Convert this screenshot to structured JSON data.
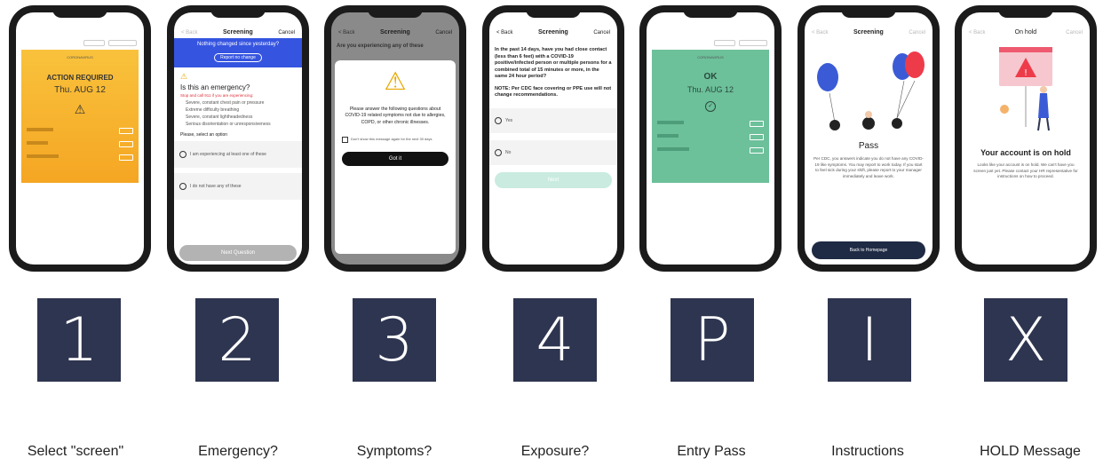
{
  "screens": [
    {
      "id": "1",
      "caption": "Select \"screen\"",
      "card": {
        "date_line": "Thu. AUG 12",
        "status": "ACTION REQUIRED",
        "header_small": "CORONAVIRUS"
      }
    },
    {
      "id": "2",
      "caption": "Emergency?",
      "nav": {
        "back": "< Back",
        "title": "Screening",
        "cancel": "Cancel"
      },
      "banner": {
        "text": "Nothing changed since yesterday?",
        "button": "Report no change"
      },
      "question": "Is this an emergency?",
      "warning": "Stop and call 911 if you are experiencing:",
      "bullets": [
        "Severe, constant chest pain or pressure",
        "Extreme difficulty breathing",
        "Severe, constant lightheadedness",
        "Serious disorientation or unresponsiveness"
      ],
      "select_label": "Please, select an option",
      "options": [
        "I am experiencing at least one of these",
        "I do not have any of these"
      ],
      "next_button": "Next Question"
    },
    {
      "id": "3",
      "caption": "Symptoms?",
      "nav": {
        "back": "< Back",
        "title": "Screening",
        "cancel": "Cancel"
      },
      "header_question": "Are you experiencing any of these",
      "modal_text": "Please answer the following questions about COVID-19 related symptoms not due to allergies, COPD, or other chronic illnesses.",
      "checkbox_label": "Don't show this message again for the next 30 days",
      "button": "Got it"
    },
    {
      "id": "4",
      "caption": "Exposure?",
      "nav": {
        "back": "< Back",
        "title": "Screening",
        "cancel": "Cancel"
      },
      "question": "In the past 14 days, have you had close contact (less than 6 feet) with a COVID-19 positive/infected person or multiple persons for a combined total of 15 minutes or more, in the same 24 hour period?",
      "note": "NOTE: Per CDC face covering or PPE use will not change recommendations.",
      "options": [
        "Yes",
        "No"
      ],
      "next_button": "Next"
    },
    {
      "id": "P",
      "caption": "Entry Pass",
      "card": {
        "status": "OK",
        "date_line": "Thu. AUG 12",
        "header_small": "CORONAVIRUS"
      }
    },
    {
      "id": "I",
      "caption": "Instructions",
      "nav": {
        "back": "< Back",
        "title": "Screening",
        "cancel": "Cancel"
      },
      "result_title": "Pass",
      "result_text": "Per CDC, you answers indicate you do not have any COVID-19 like symptoms. You may report to work today. If you start to feel sick during your shift, please report to your manager immediately and leave work.",
      "button": "Back to Homepage"
    },
    {
      "id": "X",
      "caption": "HOLD Message",
      "nav": {
        "back": "< Back",
        "title": "On hold",
        "cancel": "Cancel"
      },
      "hold_title": "Your account is on hold",
      "hold_text": "Looks like your account is on hold. We can't have you screen just yet. Please contact your HR representative for instructions on how to proceed."
    }
  ],
  "colors": {
    "dark_block": "#2e3550",
    "yellow_card": "#f7b731",
    "green_card": "#6cc09a",
    "banner_blue": "#3554e0",
    "warning_red": "#e0303a"
  }
}
